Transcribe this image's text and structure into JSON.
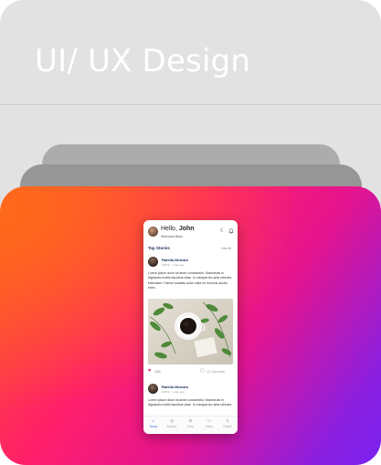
{
  "banner": {
    "title": "UI/ UX Design"
  },
  "phone": {
    "greeting": "Hello, ",
    "user_name": "John",
    "welcome": "Welcome Back",
    "section_title": "Top Stories",
    "view_all": "View All",
    "posts": [
      {
        "author": "Rafella Mendes",
        "meta": "1667D · 1 day ago",
        "text": "Lorem ipsum dolor sit amet consectetur. Maecenas in dignissim mollis faucibus vitae. In volutpat leo ante ultricies bibendum. Fames sodales dolor nulla mi rhoncus auctor enim.",
        "likes": "265K",
        "comments": "12 Comments"
      },
      {
        "author": "Rafella Mendes",
        "meta": "1667D · 1 day ago",
        "text": "Lorem ipsum dolor sit amet consectetur. Maecenas in dignissim mollis faucibus vitae. In volutpat leo ante ultricies"
      }
    ],
    "tabs": [
      {
        "label": "Home",
        "icon": "home-icon",
        "glyph": "⌂"
      },
      {
        "label": "Explore",
        "icon": "explore-icon",
        "glyph": "◎"
      },
      {
        "label": "Post",
        "icon": "post-icon",
        "glyph": "⊕"
      },
      {
        "label": "Mess",
        "icon": "message-icon",
        "glyph": "▭"
      },
      {
        "label": "Profile",
        "icon": "profile-icon",
        "glyph": "♙"
      }
    ]
  },
  "colors": {
    "gradient_start": "#ff5a24",
    "gradient_mid": "#ff1f6a",
    "gradient_end": "#7a22f0",
    "accent": "#3b6fd8",
    "like": "#e8245c"
  }
}
